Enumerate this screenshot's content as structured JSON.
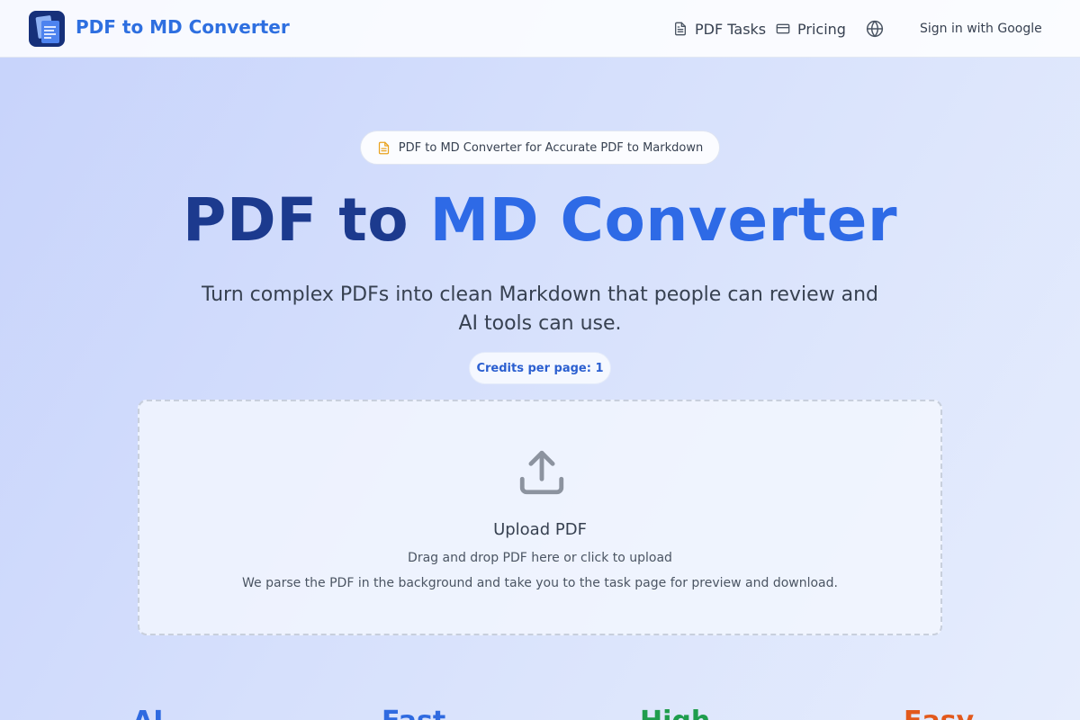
{
  "navbar": {
    "brand": "PDF to MD Converter",
    "logo_icon": "stacked-document-logo",
    "links": [
      {
        "label": "PDF Tasks",
        "icon": "document-icon"
      },
      {
        "label": "Pricing",
        "icon": "credit-card-icon"
      }
    ],
    "language_icon": "globe-icon",
    "sign_in_label": "Sign in with Google"
  },
  "hero": {
    "badge_icon": "document-icon",
    "badge_text": "PDF to MD Converter for Accurate PDF to Markdown",
    "title_part1": "PDF to",
    "title_part2": "MD Converter",
    "subtitle": "Turn complex PDFs into clean Markdown that people can review and AI tools can use.",
    "credits_label": "Credits per page: 1"
  },
  "upload": {
    "icon": "upload-icon",
    "title": "Upload PDF",
    "instruction": "Drag and drop PDF here or click to upload",
    "description": "We parse the PDF in the background and take you to the task page for preview and download."
  },
  "features": [
    {
      "label": "AI",
      "color": "#2f6ae0"
    },
    {
      "label": "Fast",
      "color": "#2f6ae0"
    },
    {
      "label": "High",
      "color": "#1f9d4d"
    },
    {
      "label": "Easy",
      "color": "#e2591c"
    }
  ],
  "colors": {
    "brand": "#2e6fe0",
    "title_dark": "#1c3a8e",
    "title_light": "#2e6ae6",
    "badge_icon": "#e9a320"
  }
}
